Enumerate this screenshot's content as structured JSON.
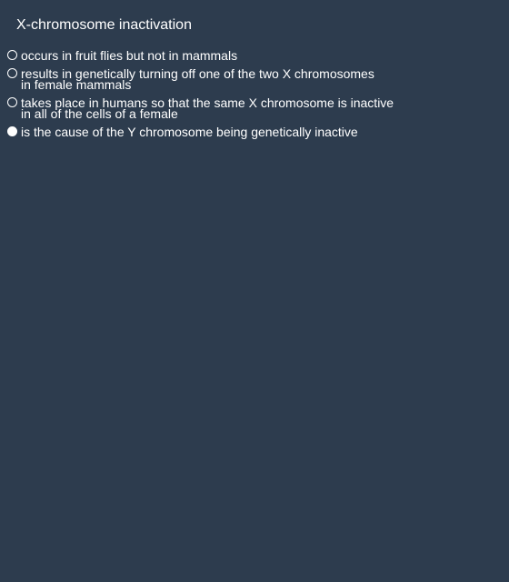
{
  "question": {
    "title": "X-chromosome inactivation",
    "options": [
      {
        "label": "occurs in fruit flies but not in mammals",
        "selected": false
      },
      {
        "label": "results in genetically turning off one of the two X chromosomes\nin female mammals",
        "selected": false
      },
      {
        "label": "takes place in humans so that the same X chromosome is inactive\nin all of the cells of a female",
        "selected": false
      },
      {
        "label": "is the cause of the Y chromosome being genetically inactive",
        "selected": true
      }
    ]
  },
  "colors": {
    "background": "#2d3c4e",
    "text": "#ffffff"
  }
}
